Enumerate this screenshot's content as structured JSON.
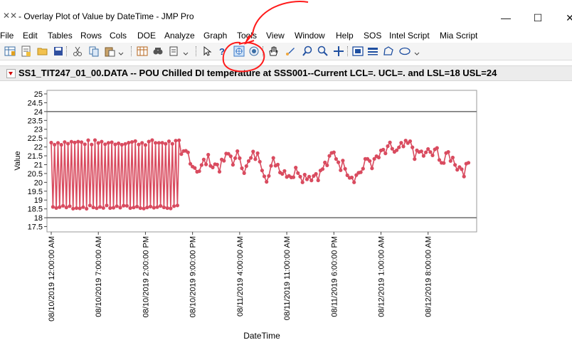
{
  "window": {
    "app_icon": "jmp-icon",
    "title": " - Overlay Plot of Value by DateTime - JMP Pro",
    "minimize_glyph": "—",
    "maximize_glyph": "☐",
    "close_glyph": "✕"
  },
  "menu": [
    "File",
    "Edit",
    "Tables",
    "Rows",
    "Cols",
    "DOE",
    "Analyze",
    "Graph",
    "Tools",
    "View",
    "Window",
    "Help",
    "SOS",
    "Intel Script",
    "Mia Script"
  ],
  "toolbar": {
    "icons": [
      "new-data-table-icon",
      "new-script-icon",
      "open-icon",
      "save-icon",
      "cut-icon",
      "copy-icon",
      "paste-icon",
      "data-grid-icon",
      "data-view-icon",
      "journal-icon",
      "arrow-tool-icon",
      "help-tool-icon",
      "selection-tool-icon",
      "lasso-tool-icon",
      "hand-tool-icon",
      "brush-tool-icon",
      "zoom-out-tool-icon",
      "zoom-tool-icon",
      "crosshair-tool-icon",
      "annotate-tool-icon",
      "line-tool-icon",
      "polygon-tool-icon",
      "simple-shape-tool-icon"
    ]
  },
  "report": {
    "title": "SS1_TIT247_01_00.DATA -- POU Chilled DI temperature at SSS001--Current   LCL=.  UCL=. and  LSL=18  USL=24"
  },
  "chart_data": {
    "type": "line",
    "xlabel": "DateTime",
    "ylabel": "Value",
    "ylim": [
      17.2,
      25.2
    ],
    "y_ticks": [
      "25",
      "24.5",
      "24",
      "23.5",
      "23",
      "22.5",
      "22",
      "21.5",
      "21",
      "20.5",
      "20",
      "19.5",
      "19",
      "18.5",
      "18",
      "17.5"
    ],
    "x_ticks": [
      "08/10/2019 12:00:00 AM",
      "08/10/2019 7:00:00 AM",
      "08/10/2019 2:00:00 PM",
      "08/10/2019 9:00:00 PM",
      "08/11/2019 4:00:00 AM",
      "08/11/2019 11:00:00 AM",
      "08/11/2019 6:00:00 PM",
      "08/12/2019 1:00:00 AM",
      "08/12/2019 8:00:00 AM"
    ],
    "x_range": [
      "08/10/2019 12:00:00 AM",
      "08/12/2019 2:35:00 PM"
    ],
    "reference_lines": [
      {
        "name": "USL",
        "value": 24
      },
      {
        "name": "LSL",
        "value": 18
      }
    ],
    "series": [
      {
        "color": "#d94b5f",
        "segments": [
          {
            "from": "08/10/2019 12:00:00 AM",
            "to": "08/10/2019 7:00:00 PM",
            "oscillation_low": [
              18.5,
              18.7
            ],
            "oscillation_high": [
              22.1,
              22.4
            ],
            "cycle_minutes": 30
          },
          {
            "from": "08/10/2019 7:00:00 PM",
            "to": "08/12/2019 2:00:00 PM",
            "range": [
              20.0,
              22.4
            ],
            "center": 21.2
          }
        ]
      }
    ]
  },
  "annotation": {
    "color": "#ff1a1a"
  }
}
